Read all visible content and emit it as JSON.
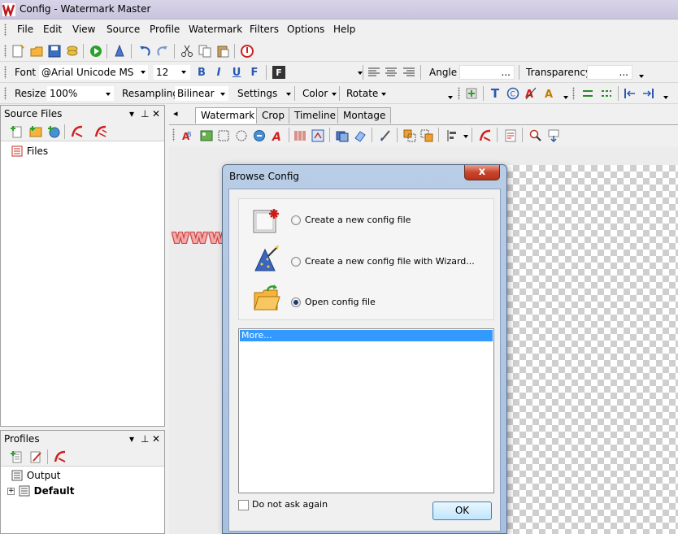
{
  "window": {
    "title": "Config - Watermark Master"
  },
  "menu": [
    "File",
    "Edit",
    "View",
    "Source",
    "Profile",
    "Watermark",
    "Filters",
    "Options",
    "Help"
  ],
  "font_toolbar": {
    "font_label": "Font",
    "font_value": "@Arial Unicode MS",
    "size_value": "12",
    "angle_label": "Angle",
    "angle_value": "...",
    "transparency_label": "Transparency",
    "transparency_value": "..."
  },
  "image_toolbar": {
    "resize_label": "Resize",
    "resize_value": "100%",
    "resampling_label": "Resampling",
    "resampling_value": "Bilinear",
    "settings_label": "Settings",
    "color_label": "Color",
    "rotate_label": "Rotate"
  },
  "source_files": {
    "title": "Source Files",
    "tree_root": "Files"
  },
  "profiles": {
    "title": "Profiles",
    "items": [
      "Output",
      "Default"
    ]
  },
  "tabs": [
    "Watermark",
    "Crop",
    "Timeline",
    "Montage"
  ],
  "dialog": {
    "title": "Browse Config",
    "close": "x",
    "options": [
      {
        "label": "Create a new config file",
        "checked": false
      },
      {
        "label": "Create a new config file with Wizard...",
        "checked": false
      },
      {
        "label": "Open config file",
        "checked": true
      }
    ],
    "recent_items": [
      "More..."
    ],
    "dont_ask_label": "Do not ask again",
    "ok_label": "OK"
  },
  "overlay_watermark": "www.hackingarticles.in",
  "colors": {
    "selection": "#3399ff",
    "title_bar": "#c9c4dc",
    "dialog_frame": "#a8c0df",
    "close_button": "#c8452c"
  }
}
